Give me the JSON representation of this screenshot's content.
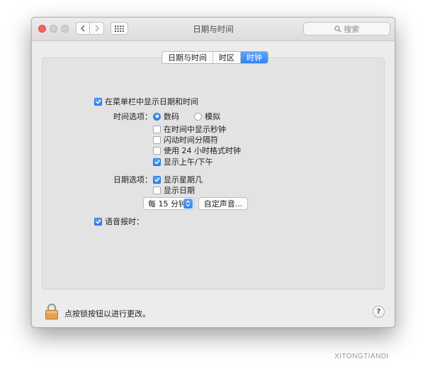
{
  "window": {
    "title": "日期与时间",
    "search_placeholder": "搜索"
  },
  "tabs": [
    {
      "label": "日期与时间",
      "active": false
    },
    {
      "label": "时区",
      "active": false
    },
    {
      "label": "时钟",
      "active": true
    }
  ],
  "clock": {
    "show_in_menubar": {
      "label": "在菜单栏中显示日期和时间",
      "checked": true
    },
    "time_options": {
      "label": "时间选项：",
      "digital": {
        "label": "数码",
        "selected": true
      },
      "analog": {
        "label": "模拟",
        "selected": false
      },
      "show_seconds": {
        "label": "在时间中显示秒钟",
        "checked": false
      },
      "flash_separators": {
        "label": "闪动时间分隔符",
        "checked": false
      },
      "use_24_hour": {
        "label": "使用 24 小时格式时钟",
        "checked": false
      },
      "show_am_pm": {
        "label": "显示上午/下午",
        "checked": true
      }
    },
    "date_options": {
      "label": "日期选项：",
      "show_weekday": {
        "label": "显示星期几",
        "checked": true
      },
      "show_date": {
        "label": "显示日期",
        "checked": false
      }
    },
    "announce_time": {
      "label": "语音报时：",
      "checked": true,
      "interval_selected": "每 15 分钟",
      "customize_voice_button": "自定声音..."
    }
  },
  "footer": {
    "lock_text": "点按锁按钮以进行更改。",
    "help_glyph": "?"
  },
  "colors": {
    "accent": "#2e80f4",
    "window_bg": "#ececec",
    "panel_bg": "#e3e3e3"
  },
  "icons": {
    "back": "chevron-left-icon",
    "forward": "chevron-right-icon",
    "grid": "grid-icon",
    "search": "search-icon",
    "lock": "lock-icon",
    "help": "help-icon"
  },
  "watermark": "XITONGTIANDI"
}
